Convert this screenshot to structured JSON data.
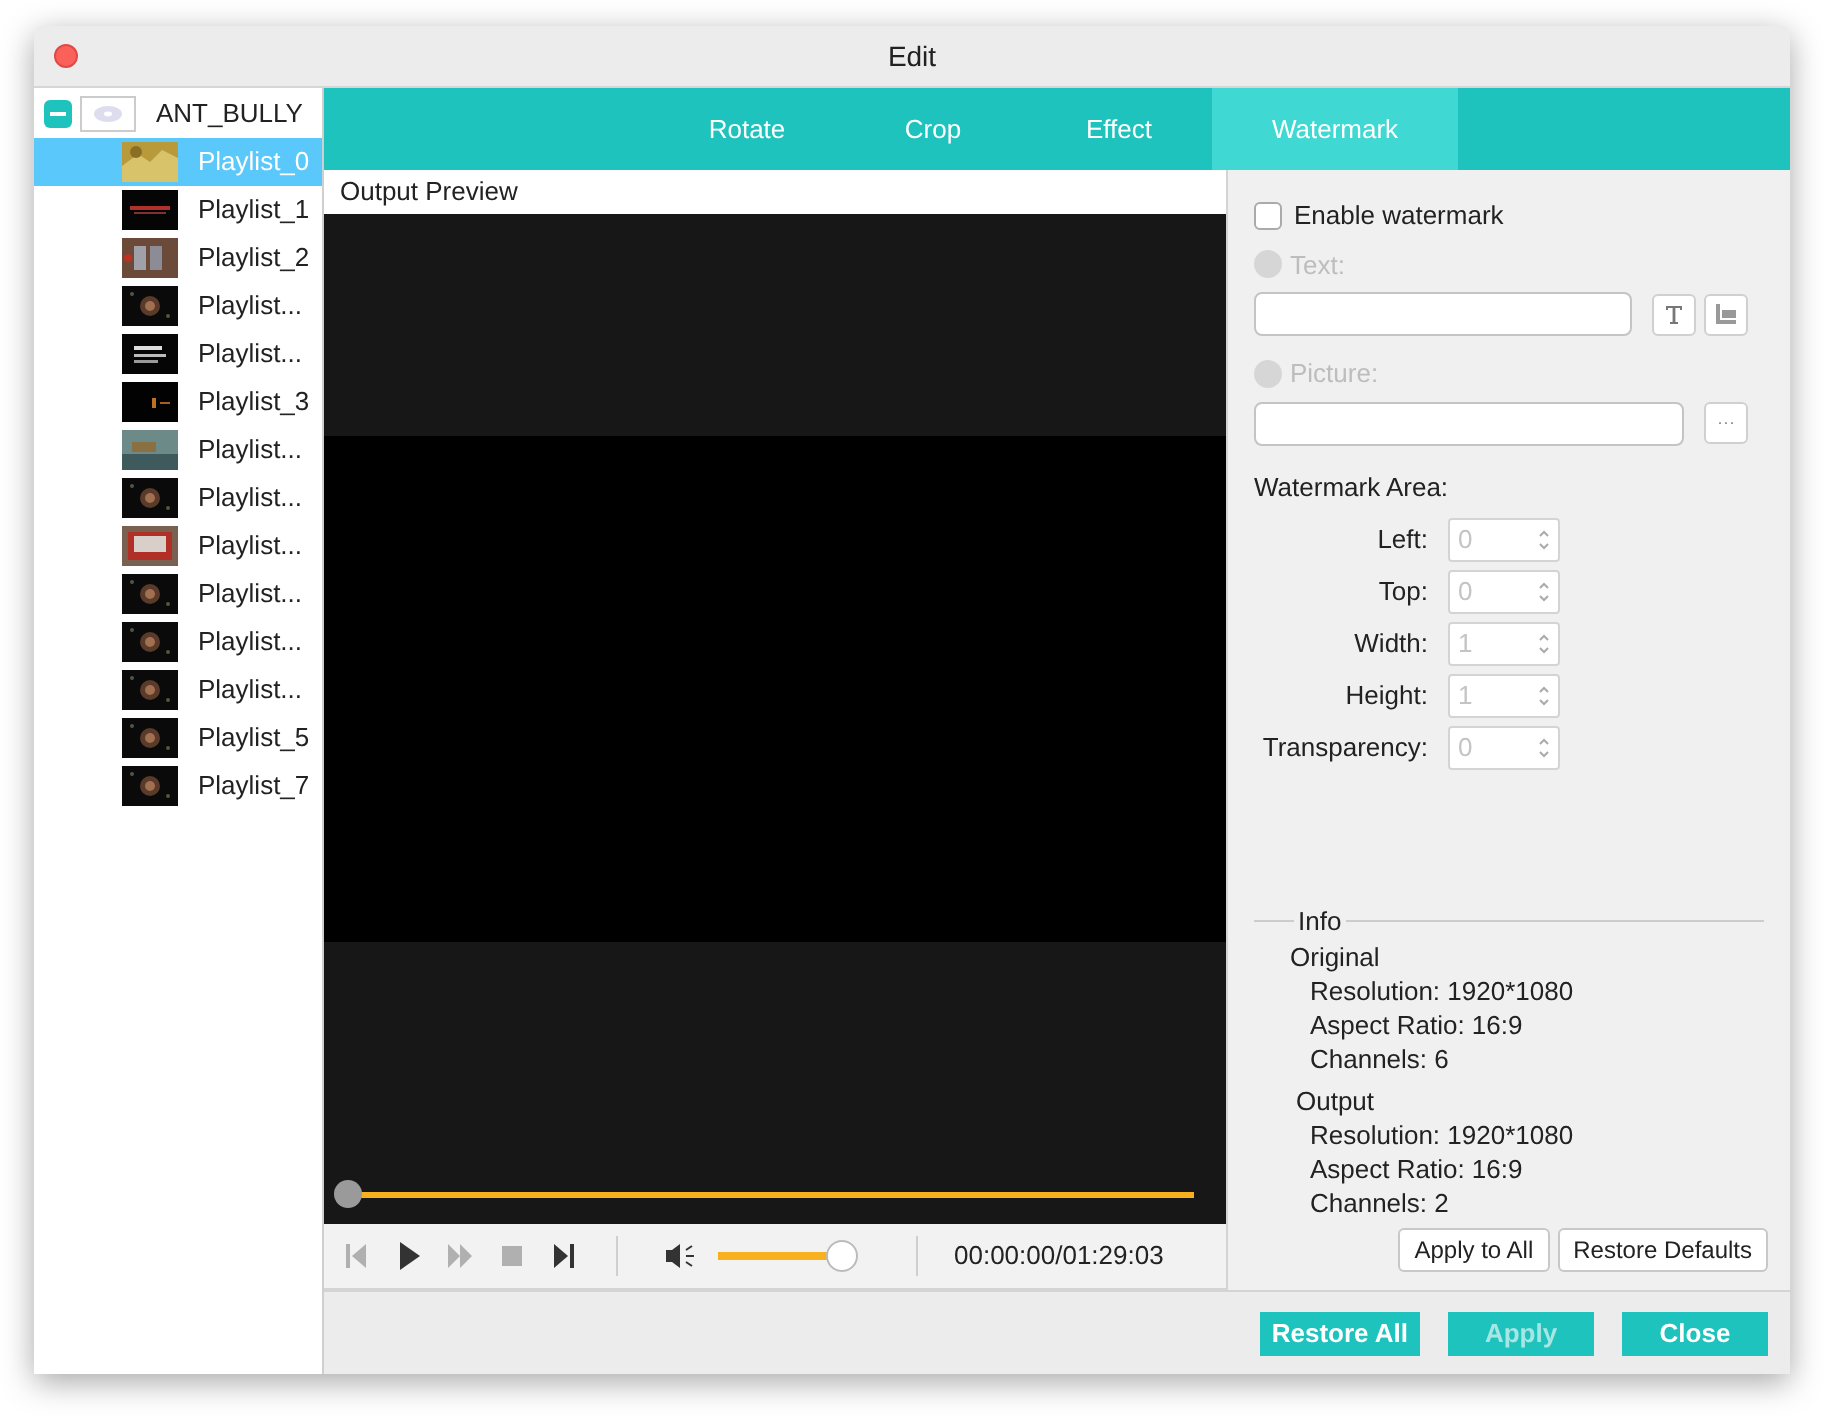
{
  "window": {
    "title": "Edit"
  },
  "tree": {
    "label": "ANT_BULLY",
    "expanded": true,
    "children": [
      {
        "label": "Playlist_0",
        "selected": true
      },
      {
        "label": "Playlist_1",
        "selected": false
      },
      {
        "label": "Playlist_2",
        "selected": false
      },
      {
        "label": "Playlist...",
        "selected": false
      },
      {
        "label": "Playlist...",
        "selected": false
      },
      {
        "label": "Playlist_3",
        "selected": false
      },
      {
        "label": "Playlist...",
        "selected": false
      },
      {
        "label": "Playlist...",
        "selected": false
      },
      {
        "label": "Playlist...",
        "selected": false
      },
      {
        "label": "Playlist...",
        "selected": false
      },
      {
        "label": "Playlist...",
        "selected": false
      },
      {
        "label": "Playlist...",
        "selected": false
      },
      {
        "label": "Playlist_5",
        "selected": false
      },
      {
        "label": "Playlist_7",
        "selected": false
      }
    ]
  },
  "tabs": [
    {
      "label": "Rotate",
      "selected": false
    },
    {
      "label": "Crop",
      "selected": false
    },
    {
      "label": "Effect",
      "selected": false
    },
    {
      "label": "Watermark",
      "selected": true
    }
  ],
  "preview": {
    "label": "Output Preview",
    "seek": {
      "level": 0
    },
    "controls": [
      {
        "kind": "previous",
        "disabled": true
      },
      {
        "kind": "play",
        "disabled": false
      },
      {
        "kind": "forward",
        "disabled": true
      },
      {
        "kind": "stop",
        "disabled": true
      },
      {
        "kind": "next",
        "disabled": false
      }
    ],
    "volume": {
      "level": 0.9
    },
    "time": "00:00:00/01:29:03"
  },
  "watermark": {
    "enable": {
      "label": "Enable watermark",
      "checked": false
    },
    "text_option": {
      "label": "Text:",
      "selected": false,
      "disabled": true
    },
    "picture_option": {
      "label": "Picture:",
      "selected": false,
      "disabled": true
    },
    "area_label": "Watermark Area:",
    "fields": [
      {
        "label": "Left:",
        "value": "0"
      },
      {
        "label": "Top:",
        "value": "0"
      },
      {
        "label": "Width:",
        "value": "1"
      },
      {
        "label": "Height:",
        "value": "1"
      },
      {
        "label": "Transparency:",
        "value": "0"
      }
    ],
    "browse": "···"
  },
  "info": {
    "title": "Info",
    "groups": [
      {
        "title": "Original",
        "lines": [
          "Resolution: 1920*1080",
          "Aspect Ratio: 16:9",
          "Channels: 6"
        ]
      },
      {
        "title": "Output",
        "lines": [
          "Resolution: 1920*1080",
          "Aspect Ratio: 16:9",
          "Channels: 2"
        ]
      }
    ]
  },
  "panel_buttons": [
    "Apply to All",
    "Restore Defaults"
  ],
  "footer_buttons": [
    {
      "label": "Restore All",
      "disabled": false
    },
    {
      "label": "Apply",
      "disabled": true
    },
    {
      "label": "Close",
      "disabled": false
    }
  ]
}
